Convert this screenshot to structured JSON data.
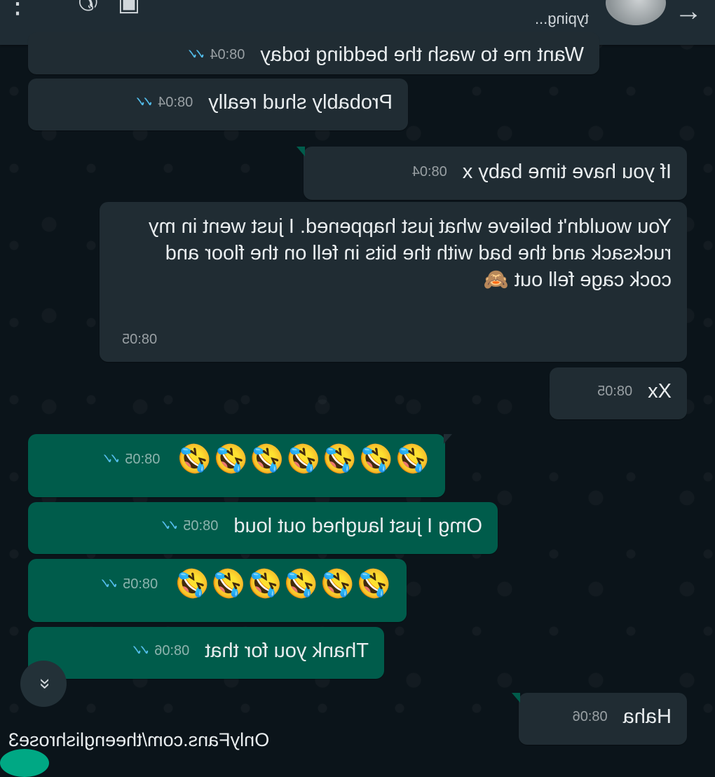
{
  "header": {
    "status": "typing...",
    "icons": [
      "back-arrow-icon",
      "video-call-icon",
      "voice-call-icon",
      "more-options-icon"
    ]
  },
  "messages": [
    {
      "dir": "in",
      "text": "Want me to wash the bedding today",
      "time": "08:04"
    },
    {
      "dir": "in",
      "text": "Probably shud really",
      "time": "08:04"
    },
    {
      "dir": "out",
      "text": "If you have time baby x",
      "time": "08:04"
    },
    {
      "dir": "out",
      "text": "You wouldn't believe what just happened. I just went in my rucksack and the bad with the bits in fell on the floor and cock cage fell out 🙈",
      "time": "08:05"
    },
    {
      "dir": "out",
      "text": "Xx",
      "time": "08:05"
    },
    {
      "dir": "in",
      "text": "🤣🤣🤣🤣🤣🤣🤣",
      "time": "08:05"
    },
    {
      "dir": "in",
      "text": "Omg I just laughed out loud",
      "time": "08:05"
    },
    {
      "dir": "in",
      "text": "🤣🤣🤣🤣🤣🤣",
      "time": "08:05"
    },
    {
      "dir": "in",
      "text": "Thank you for that",
      "time": "08:06"
    },
    {
      "dir": "out",
      "text": "Haha",
      "time": "08:06"
    }
  ],
  "watermark": "OnlyFans.com/theenglishrose3",
  "colors": {
    "background": "#0b141a",
    "incoming": "#202c33",
    "outgoing": "#005c4b",
    "ticks": "#53bdeb"
  }
}
